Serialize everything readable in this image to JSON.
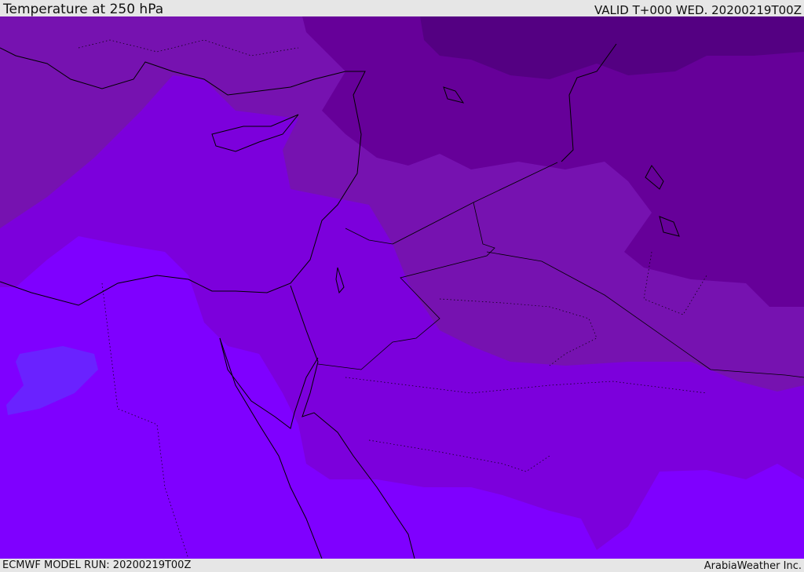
{
  "header": {
    "title": "Temperature at 250 hPa",
    "valid": "VALID T+000 WED. 20200219T00Z"
  },
  "footer": {
    "model_run": "ECMWF MODEL RUN: 20200219T00Z",
    "credit": "ArabiaWeather Inc."
  },
  "colors": {
    "band_darkest": "#540082",
    "band_dark": "#660099",
    "band_medium": "#7612b0",
    "band_mid": "#7c00dc",
    "band_bright": "#7f00ff",
    "band_blue_patch": "#6a22ff",
    "coastline": "#000000"
  }
}
